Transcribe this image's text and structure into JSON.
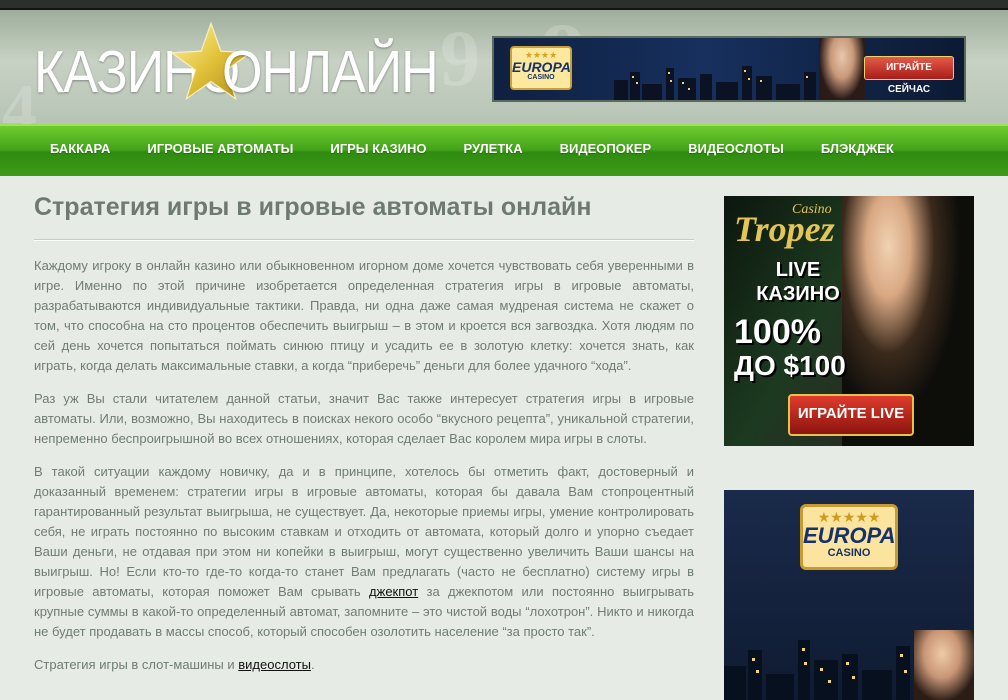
{
  "header": {
    "logo_left": "КАЗИНО",
    "logo_right": "ОНЛАЙН",
    "top_banner": {
      "brand_line1": "EUROPA",
      "brand_line2": "CASINO",
      "button": "ИГРАЙТЕ СЕЙЧАС"
    }
  },
  "nav": {
    "items": [
      "БАККАРА",
      "ИГРОВЫЕ АВТОМАТЫ",
      "ИГРЫ КАЗИНО",
      "РУЛЕТКА",
      "ВИДЕОПОКЕР",
      "ВИДЕОСЛОТЫ",
      "БЛЭКДЖЕК"
    ]
  },
  "article": {
    "title": "Стратегия игры в игровые автоматы онлайн",
    "p1": "Каждому игроку в онлайн казино или обыкновенном игорном доме хочется чувствовать себя уверенными в игре. Именно по этой причине изобретается определенная стратегия игры в игровые автоматы, разрабатываются индивидуальные тактики. Правда, ни одна даже самая мудреная система не скажет о том, что способна на сто процентов обеспечить выигрыш – в этом и кроется вся загвоздка. Хотя людям по сей день хочется попытаться поймать синюю птицу и усадить ее в золотую клетку: хочется знать, как играть, когда делать максимальные ставки, а когда “приберечь” деньги для более удачного “хода”.",
    "p2": "Раз уж Вы стали читателем данной статьи, значит Вас также интересует стратегия игры в игровые автоматы. Или, возможно, Вы находитесь в поисках некого особо “вкусного рецепта”, уникальной стратегии, непременно беспроигрышной во всех отношениях, которая сделает Вас королем мира игры в слоты.",
    "p3_before": "В такой ситуации каждому новичку, да и в принципе, хотелось бы отметить факт, достоверный и доказанный временем: стратегии игры в игровые автоматы, которая бы давала Вам стопроцентный гарантированный результат выигрыша, не существует. Да, некоторые приемы игры, умение контролировать себя, не играть постоянно по высоким ставкам и отходить от автомата, который долго и упорно съедает Ваши деньги, не отдавая при этом ни копейки в выигрыш, могут существенно увеличить Ваши шансы на выигрыш. Но! Если кто-то где-то когда-то станет Вам предлагать (часто не бесплатно) систему игры в игровые автоматы, которая поможет Вам срывать ",
    "p3_link": "джекпот",
    "p3_after": " за джекпотом или постоянно выигрывать крупные суммы в какой-то определенный автомат, запомните – это чистой воды “лохотрон”. Никто и никогда не будет продавать в массы способ, который способен озолотить население “за просто так”.",
    "p4_before": "Стратегия игры в слот-машины и ",
    "p4_link": "видеослоты",
    "p4_after": "."
  },
  "sidebar": {
    "tropez": {
      "brand_small": "Casino",
      "brand_big": "Tropez",
      "live_line1": "LIVE",
      "live_line2": "КАЗИНО",
      "percent": "100%",
      "amount": "ДО $100",
      "button": "ИГРАЙТЕ LIVE"
    },
    "europa": {
      "brand_line1": "EUROPA",
      "brand_line2": "CASINO"
    }
  },
  "colors": {
    "nav_green": "#42a31a",
    "text": "#6e7c74",
    "title": "#6c7a72",
    "gold": "#e3c558"
  }
}
